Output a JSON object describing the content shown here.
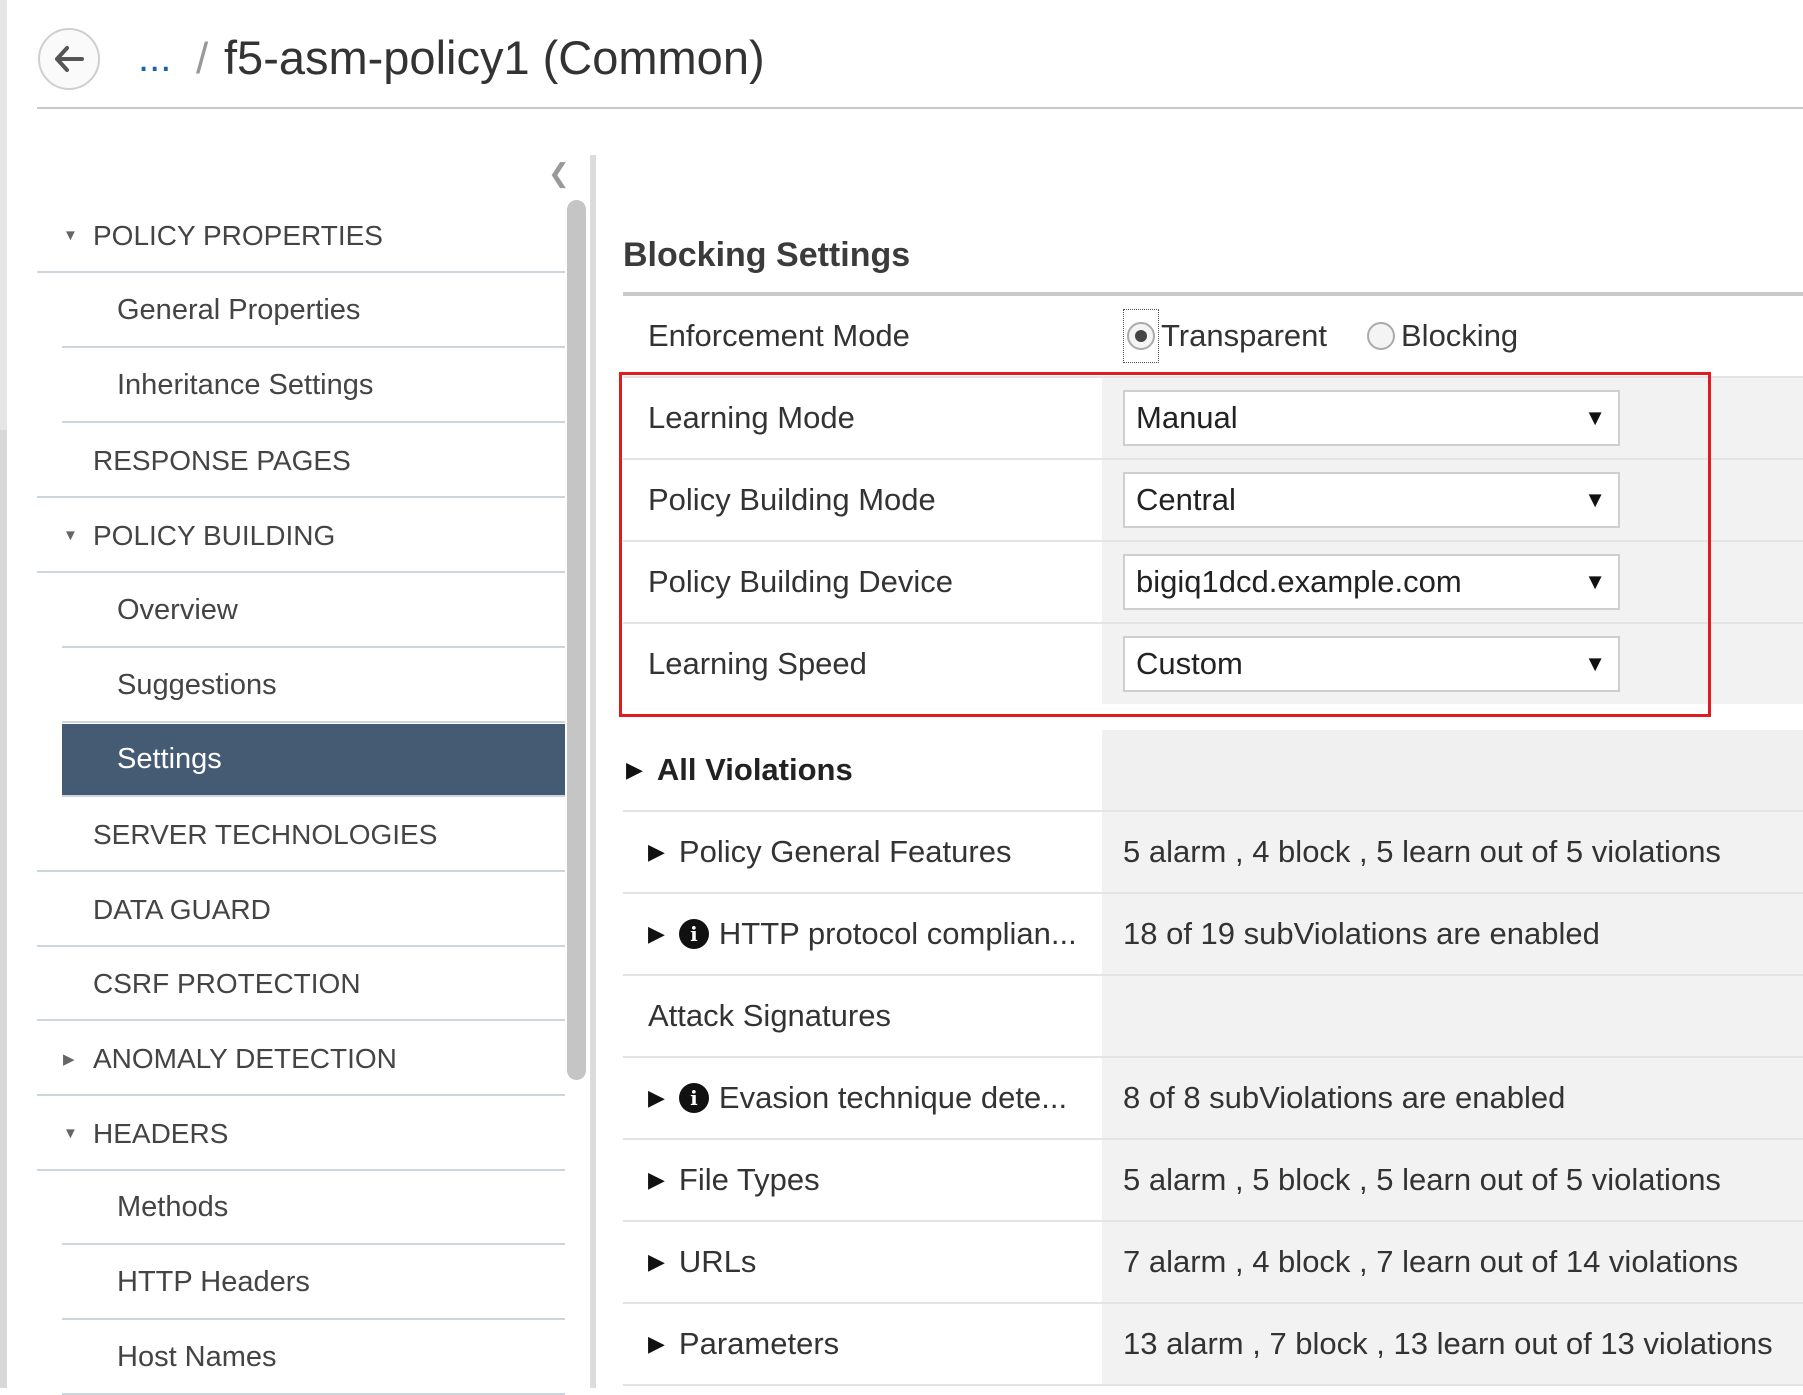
{
  "header": {
    "breadcrumb_ellipsis": "...",
    "separator": "/",
    "title": "f5-asm-policy1 (Common)"
  },
  "sidebar": {
    "items": [
      {
        "label": "POLICY PROPERTIES",
        "type": "section",
        "expanded": true
      },
      {
        "label": "General Properties",
        "type": "child"
      },
      {
        "label": "Inheritance Settings",
        "type": "child"
      },
      {
        "label": "RESPONSE PAGES",
        "type": "section"
      },
      {
        "label": "POLICY BUILDING",
        "type": "section",
        "expanded": true
      },
      {
        "label": "Overview",
        "type": "child"
      },
      {
        "label": "Suggestions",
        "type": "child"
      },
      {
        "label": "Settings",
        "type": "child",
        "active": true
      },
      {
        "label": "SERVER TECHNOLOGIES",
        "type": "section"
      },
      {
        "label": "DATA GUARD",
        "type": "section"
      },
      {
        "label": "CSRF PROTECTION",
        "type": "section"
      },
      {
        "label": "ANOMALY DETECTION",
        "type": "section",
        "expanded": false
      },
      {
        "label": "HEADERS",
        "type": "section",
        "expanded": true
      },
      {
        "label": "Methods",
        "type": "child"
      },
      {
        "label": "HTTP Headers",
        "type": "child"
      },
      {
        "label": "Host Names",
        "type": "child"
      }
    ]
  },
  "main": {
    "section_title": "Blocking Settings",
    "enforcement": {
      "label": "Enforcement Mode",
      "options": [
        "Transparent",
        "Blocking"
      ],
      "selected": "Transparent"
    },
    "learning_mode": {
      "label": "Learning Mode",
      "value": "Manual"
    },
    "policy_building_mode": {
      "label": "Policy Building Mode",
      "value": "Central"
    },
    "policy_building_device": {
      "label": "Policy Building Device",
      "value": "bigiq1dcd.example.com"
    },
    "learning_speed": {
      "label": "Learning Speed",
      "value": "Custom"
    },
    "all_violations": {
      "label": "All Violations"
    },
    "violations": [
      {
        "label": "Policy General Features",
        "summary": "5 alarm , 4 block , 5 learn out of 5 violations",
        "expandable": true,
        "info": false
      },
      {
        "label": "HTTP protocol complian...",
        "summary": "18 of 19 subViolations are enabled",
        "expandable": true,
        "info": true
      },
      {
        "label": "Attack Signatures",
        "summary": "",
        "expandable": false,
        "info": false
      },
      {
        "label": "Evasion technique dete...",
        "summary": "8 of 8 subViolations are enabled",
        "expandable": true,
        "info": true
      },
      {
        "label": "File Types",
        "summary": "5 alarm , 5 block , 5 learn out of 5 violations",
        "expandable": true,
        "info": false
      },
      {
        "label": "URLs",
        "summary": "7 alarm , 4 block , 7 learn out of 14 violations",
        "expandable": true,
        "info": false
      },
      {
        "label": "Parameters",
        "summary": "13 alarm , 7 block , 13 learn out of 13 violations",
        "expandable": true,
        "info": false
      }
    ]
  },
  "colors": {
    "active_nav": "#455a73",
    "highlight": "#e11b22",
    "link": "#1a64a8"
  }
}
